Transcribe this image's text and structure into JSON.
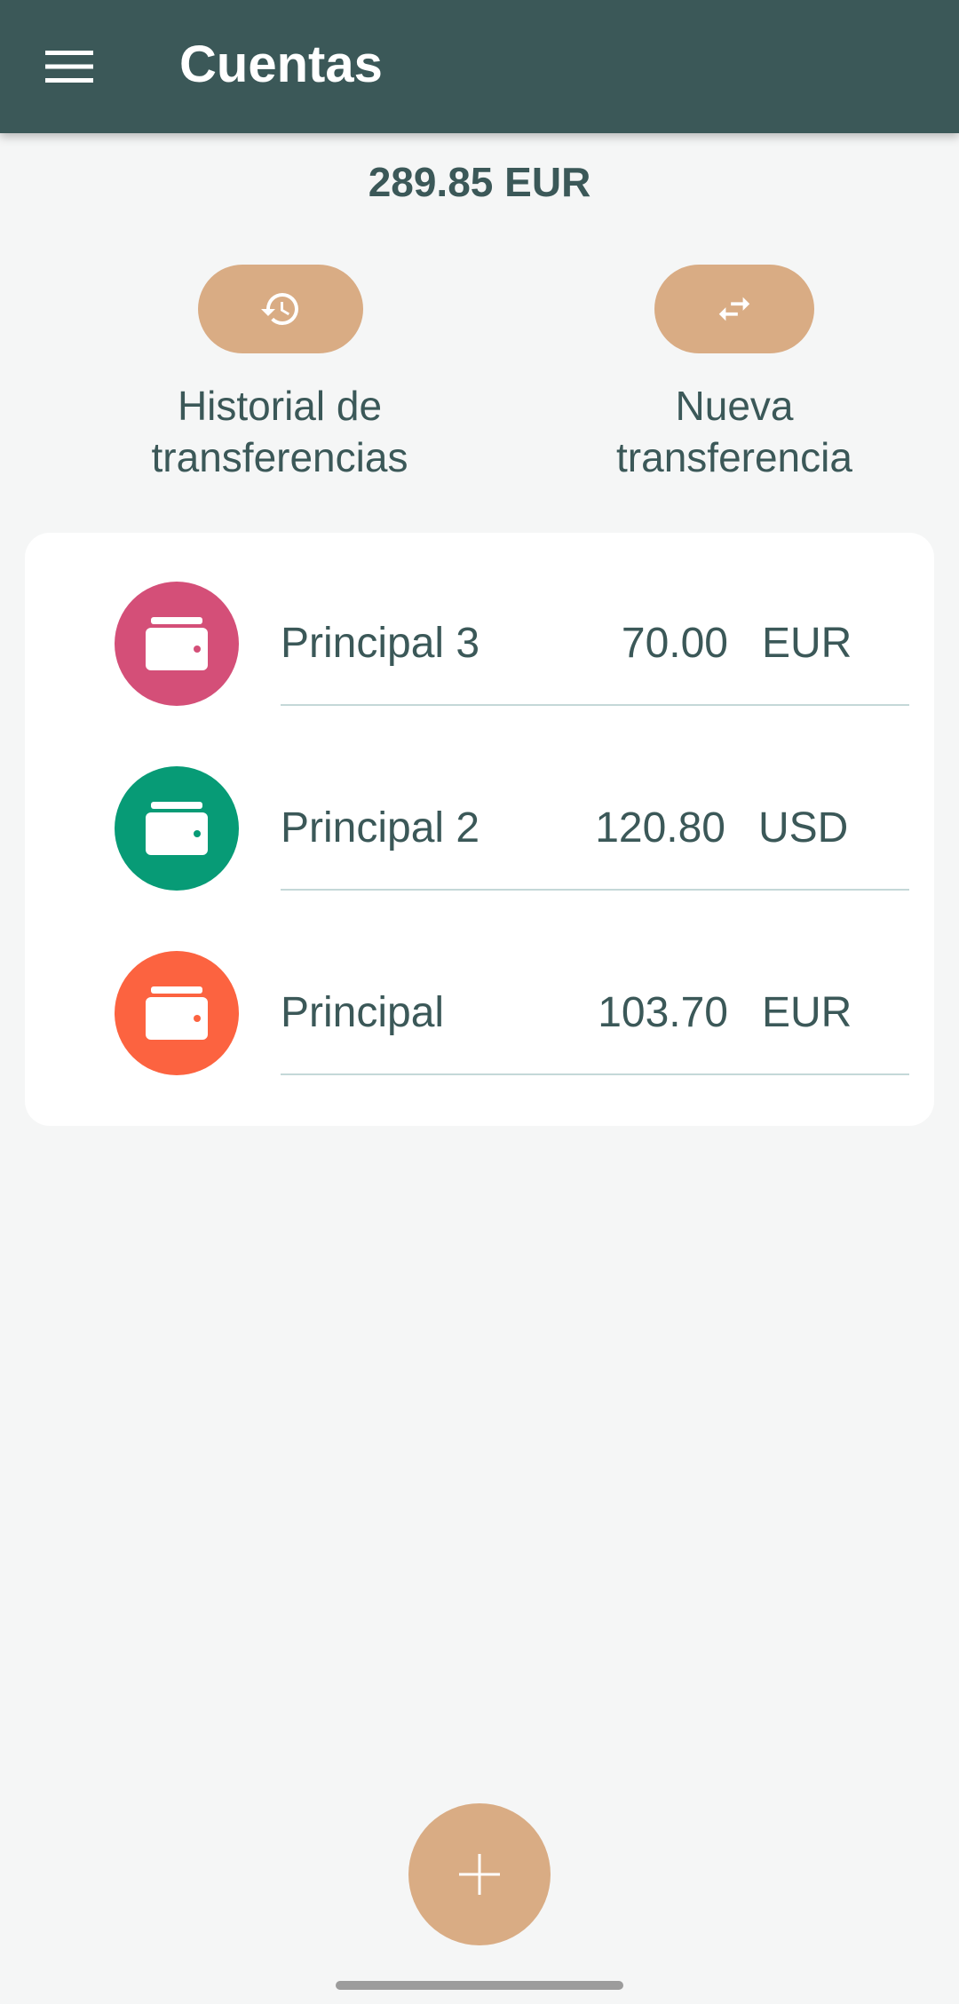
{
  "app_bar": {
    "title": "Cuentas",
    "menu_icon": "menu-icon"
  },
  "summary": {
    "total": "289.85 EUR"
  },
  "actions": [
    {
      "label": "Historial de\ntransferencias",
      "icon": "history-icon"
    },
    {
      "label": "Nueva\ntransferencia",
      "icon": "swap-arrows-icon"
    }
  ],
  "accounts": [
    {
      "name": "Principal 3",
      "amount": "70.00",
      "currency": "EUR",
      "color": "#d44f78",
      "icon": "wallet-icon"
    },
    {
      "name": "Principal 2",
      "amount": "120.80",
      "currency": "USD",
      "color": "#079b76",
      "icon": "wallet-icon"
    },
    {
      "name": "Principal",
      "amount": "103.70",
      "currency": "EUR",
      "color": "#fc6340",
      "icon": "wallet-icon"
    }
  ],
  "fab": {
    "icon": "plus-icon"
  },
  "colors": {
    "app_bar": "#3b5858",
    "accent": "#d9ac84",
    "background": "#f5f6f6",
    "text": "#3b5858"
  }
}
